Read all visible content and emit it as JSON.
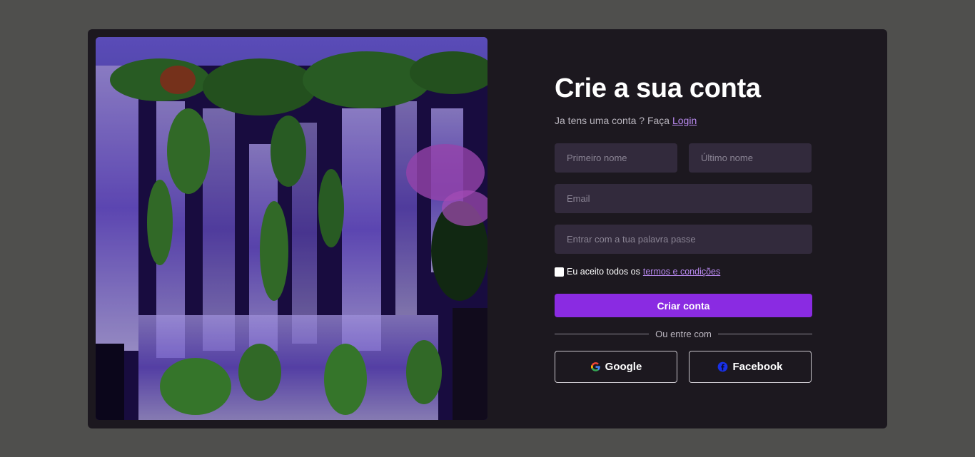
{
  "hero": {
    "icon": "waterfall-landscape-image"
  },
  "form": {
    "title": "Crie a sua conta",
    "subtitle_text": "Ja tens uma conta ? Faça",
    "login_link": "Login",
    "first_name_placeholder": "Primeiro nome",
    "last_name_placeholder": "Último nome",
    "email_placeholder": "Email",
    "password_placeholder": "Entrar com a tua palavra passe",
    "terms_text": "Eu aceito todos os",
    "terms_link": "termos e condições",
    "terms_checked": false,
    "submit_label": "Criar conta",
    "divider_label": "Ou entre com",
    "google_label": "Google",
    "facebook_label": "Facebook"
  },
  "colors": {
    "background": "#4f4f4d",
    "card": "#1c181f",
    "input": "#322a3c",
    "accent": "#8a2be2",
    "link": "#b98af0"
  },
  "icons": {
    "google": "google-icon",
    "facebook": "facebook-icon"
  }
}
